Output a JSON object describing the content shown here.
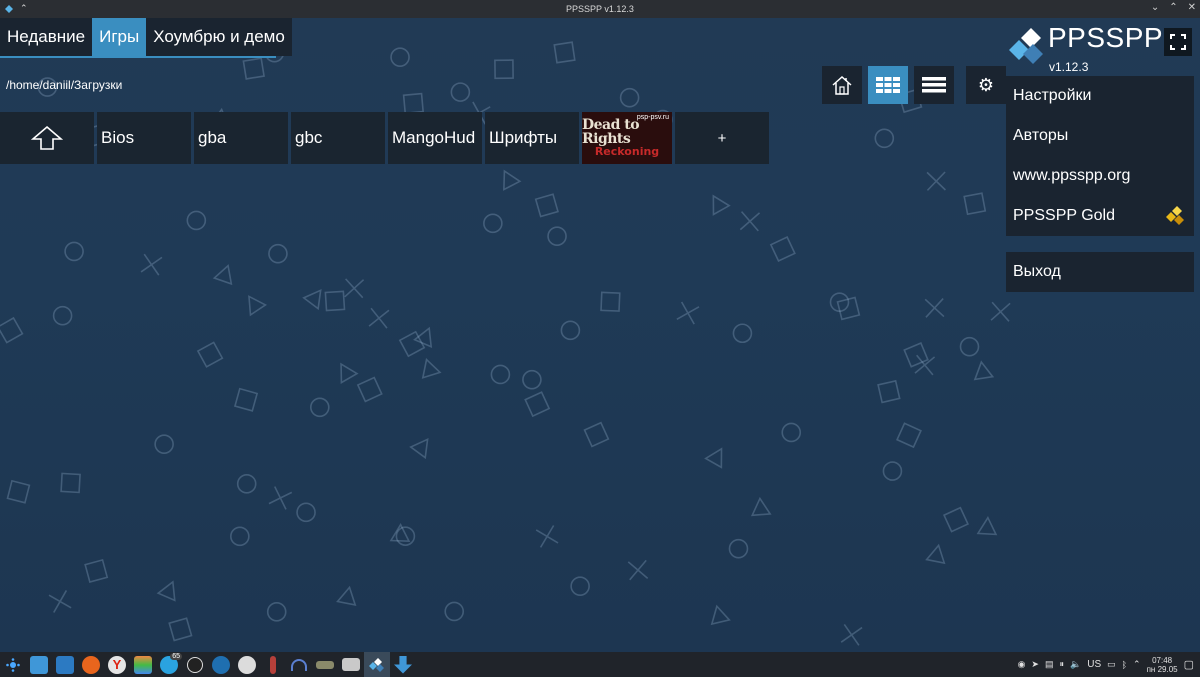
{
  "window": {
    "title": "PPSSPP v1.12.3"
  },
  "tabs": [
    {
      "label": "Недавние",
      "active": false
    },
    {
      "label": "Игры",
      "active": true
    },
    {
      "label": "Хоумбрю и демо",
      "active": false
    }
  ],
  "browser": {
    "path": "/home/daniil/Загрузки",
    "items": [
      {
        "type": "up",
        "icon": "up-arrow-icon"
      },
      {
        "type": "folder",
        "label": "Bios"
      },
      {
        "type": "folder",
        "label": "gba"
      },
      {
        "type": "folder",
        "label": "gbc"
      },
      {
        "type": "folder",
        "label": "MangoHud"
      },
      {
        "type": "folder",
        "label": "Шрифты"
      },
      {
        "type": "game",
        "title_line1": "Dead to Rights",
        "title_line2": "Reckoning",
        "watermark": "psp-psv.ru"
      },
      {
        "type": "add",
        "label": "+"
      }
    ]
  },
  "view_buttons": [
    {
      "icon": "home-icon",
      "active": false
    },
    {
      "icon": "grid-view-icon",
      "active": true
    },
    {
      "icon": "list-view-icon",
      "active": false
    },
    {
      "icon": "gear-icon",
      "active": false
    }
  ],
  "brand": {
    "name": "PPSSPP",
    "version": "v1.12.3"
  },
  "menu": {
    "items": [
      {
        "label": "Настройки"
      },
      {
        "label": "Авторы"
      },
      {
        "label": "www.ppsspp.org"
      },
      {
        "label": "PPSSPP Gold"
      }
    ],
    "exit_label": "Выход"
  },
  "taskbar": {
    "badge": "65",
    "layout": "US",
    "time": "07:48",
    "date": "пн 29.05"
  },
  "colors": {
    "accent": "#3a8ec0",
    "panel": "#1a2430",
    "background": "#1f3a56"
  }
}
